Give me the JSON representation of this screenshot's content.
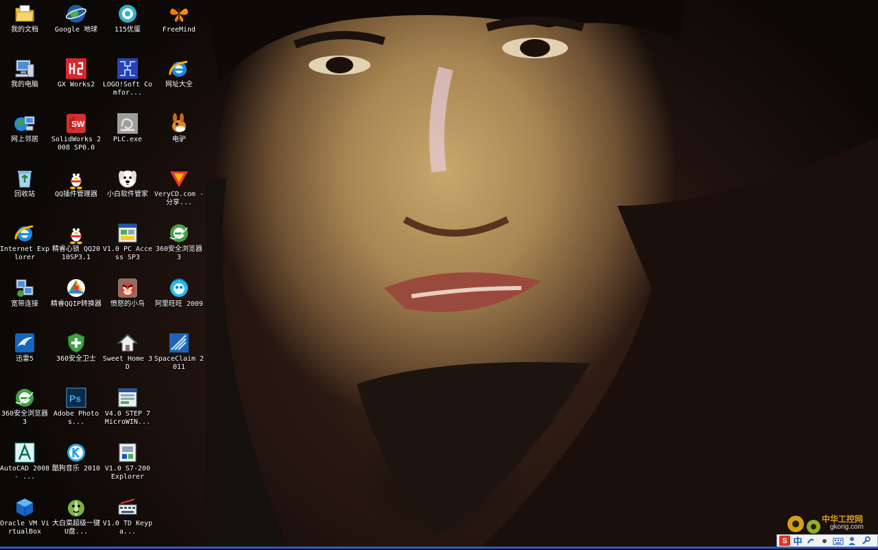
{
  "desktop": {
    "icons": [
      {
        "label": "我的文档",
        "icon": "folder-documents-icon",
        "name": "icon-my-documents"
      },
      {
        "label": "Google 地球",
        "icon": "google-earth-icon",
        "name": "icon-google-earth"
      },
      {
        "label": "115优蛋",
        "icon": "115-youdan-icon",
        "name": "icon-115-youdan"
      },
      {
        "label": "FreeMind",
        "icon": "butterfly-icon",
        "name": "icon-freemind"
      },
      {
        "label": "我的电脑",
        "icon": "computer-icon",
        "name": "icon-my-computer"
      },
      {
        "label": "GX Works2",
        "icon": "gx-works-icon",
        "name": "icon-gx-works2"
      },
      {
        "label": "LOGO!Soft Comfor...",
        "icon": "logo-soft-icon",
        "name": "icon-logo-soft"
      },
      {
        "label": "网址大全",
        "icon": "ie-icon",
        "name": "icon-url-directory"
      },
      {
        "label": "网上邻居",
        "icon": "network-icon",
        "name": "icon-network-places"
      },
      {
        "label": "SolidWorks 2008 SP0.0",
        "icon": "solidworks-icon",
        "name": "icon-solidworks"
      },
      {
        "label": "PLC.exe",
        "icon": "plc-exe-icon",
        "name": "icon-plc-exe"
      },
      {
        "label": "电驴",
        "icon": "donkey-icon",
        "name": "icon-edonkey"
      },
      {
        "label": "回收站",
        "icon": "recycle-bin-icon",
        "name": "icon-recycle-bin"
      },
      {
        "label": "QQ插件管理器",
        "icon": "qq-penguin-icon",
        "name": "icon-qq-plugin-manager"
      },
      {
        "label": "小白软件管家",
        "icon": "dog-icon",
        "name": "icon-xiaobai-manager"
      },
      {
        "label": "VeryCD.com - 分享...",
        "icon": "verycd-icon",
        "name": "icon-verycd"
      },
      {
        "label": "Internet Explorer",
        "icon": "ie-icon",
        "name": "icon-internet-explorer"
      },
      {
        "label": "精睿心锁 QQ2010SP3.1",
        "icon": "qq-penguin-icon",
        "name": "icon-qq2010"
      },
      {
        "label": "V1.0 PC Access SP3",
        "icon": "pc-access-icon",
        "name": "icon-pc-access"
      },
      {
        "label": "360安全浏览器 3",
        "icon": "360-browser-icon",
        "name": "icon-360-browser-a"
      },
      {
        "label": "宽带连接",
        "icon": "broadband-icon",
        "name": "icon-broadband"
      },
      {
        "label": "精睿QQIP转换器",
        "icon": "colorful-triangle-icon",
        "name": "icon-qqip-converter"
      },
      {
        "label": "愤怒的小鸟",
        "icon": "angry-bird-icon",
        "name": "icon-angry-birds"
      },
      {
        "label": "阿里旺旺 2009",
        "icon": "aliwangwang-icon",
        "name": "icon-aliwangwang"
      },
      {
        "label": "迅雷5",
        "icon": "thunder-icon",
        "name": "icon-xunlei"
      },
      {
        "label": "360安全卫士",
        "icon": "shield-icon",
        "name": "icon-360-safe"
      },
      {
        "label": "Sweet Home 3D",
        "icon": "sweet-home-icon",
        "name": "icon-sweet-home"
      },
      {
        "label": "SpaceClaim 2011",
        "icon": "spaceclaim-icon",
        "name": "icon-spaceclaim"
      },
      {
        "label": "360安全浏览器 3",
        "icon": "360-browser-icon",
        "name": "icon-360-browser-b"
      },
      {
        "label": "Adobe Photos...",
        "icon": "photoshop-icon",
        "name": "icon-photoshop"
      },
      {
        "label": "V4.0 STEP 7 MicroWIN...",
        "icon": "microwin-icon",
        "name": "icon-step7-microwin"
      },
      {
        "label": "",
        "icon": "",
        "name": "icon-empty-1"
      },
      {
        "label": "AutoCAD 2008 - ...",
        "icon": "autocad-icon",
        "name": "icon-autocad"
      },
      {
        "label": "酷狗音乐 2010",
        "icon": "kugou-icon",
        "name": "icon-kugou"
      },
      {
        "label": "V1.0 S7-200 Explorer",
        "icon": "s7-explorer-icon",
        "name": "icon-s7-explorer"
      },
      {
        "label": "",
        "icon": "",
        "name": "icon-empty-2"
      },
      {
        "label": "Oracle VM VirtualBox",
        "icon": "virtualbox-icon",
        "name": "icon-virtualbox"
      },
      {
        "label": "大白菜超级一键U盘...",
        "icon": "cabbage-icon",
        "name": "icon-dabaicai"
      },
      {
        "label": "V1.0 TD Keypa...",
        "icon": "keypad-icon",
        "name": "icon-td-keypad"
      },
      {
        "label": "",
        "icon": "",
        "name": "icon-empty-3"
      }
    ]
  },
  "watermark": {
    "title": "中华工控网",
    "url": "gkong.com"
  },
  "ime": {
    "brand": "S",
    "lang": "中"
  },
  "colors": {
    "desktop_text": "#ffffff",
    "taskbar": "#2d5fc8",
    "watermark_gold": "#d4a017"
  }
}
